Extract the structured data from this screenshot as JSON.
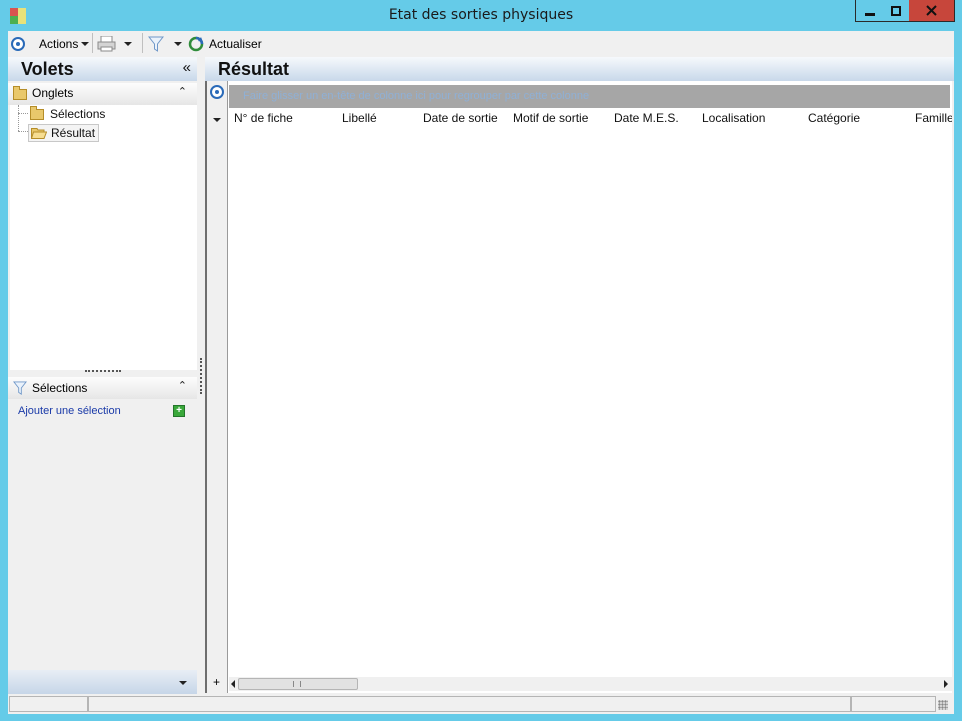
{
  "window": {
    "title": "Etat des sorties physiques",
    "controls": [
      "minimize",
      "maximize",
      "close"
    ]
  },
  "toolbar": {
    "actions_label": "Actions",
    "refresh_label": "Actualiser",
    "icons": [
      "target-icon",
      "printer-icon",
      "filter-icon",
      "refresh-icon"
    ]
  },
  "left_panel": {
    "title": "Volets",
    "collapse_glyph": "«",
    "onglets": {
      "header": "Onglets",
      "items": [
        {
          "label": "Sélections"
        },
        {
          "label": "Résultat",
          "selected": true
        }
      ]
    },
    "selections": {
      "header": "Sélections",
      "add_link": "Ajouter une sélection"
    }
  },
  "main": {
    "title": "Résultat",
    "group_panel_hint": "Faire glisser un en-tête de colonne ici pour regrouper par cette colonne",
    "columns": [
      "N° de fiche",
      "Libellé",
      "Date de sortie",
      "Motif de sortie",
      "Date M.E.S.",
      "Localisation",
      "Catégorie",
      "Famille"
    ],
    "rows": []
  },
  "colors": {
    "title_bar": "#65cbe8",
    "close_button": "#c7463b",
    "header_gradient_bottom": "#c8d8ea",
    "link_blue": "#1a3aa8",
    "group_panel": "#a6a6a6"
  }
}
